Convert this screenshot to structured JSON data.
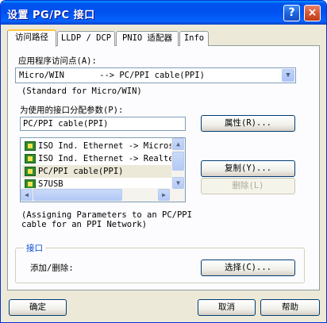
{
  "window": {
    "title": "设置 PG/PC 接口",
    "help_glyph": "?",
    "close_glyph": "×"
  },
  "tabs": [
    {
      "label": "访问路径",
      "active": true
    },
    {
      "label": "LLDP / DCP",
      "active": false
    },
    {
      "label": "PNIO 适配器",
      "active": false
    },
    {
      "label": "Info",
      "active": false
    }
  ],
  "access_point": {
    "label": "应用程序访问点(A):",
    "value": "Micro/WIN       --> PC/PPI cable(PPI)",
    "description": "(Standard for Micro/WIN)"
  },
  "interface_param": {
    "label": "为使用的接口分配参数(P):",
    "value": "PC/PPI cable(PPI)",
    "items": [
      {
        "label": "ISO Ind. Ethernet -> Microso",
        "selected": false
      },
      {
        "label": "ISO Ind. Ethernet -> Realtek",
        "selected": false
      },
      {
        "label": "PC/PPI cable(PPI)",
        "selected": true
      },
      {
        "label": "S7USB",
        "selected": false
      }
    ],
    "description_line1": "(Assigning Parameters to an PC/PPI",
    "description_line2": "cable for an PPI Network)"
  },
  "buttons": {
    "properties": "属性(R)...",
    "copy": "复制(Y)...",
    "delete": "删除(L)",
    "select": "选择(C)...",
    "ok": "确定",
    "cancel": "取消",
    "help": "帮助"
  },
  "interface_group": {
    "title": "接口",
    "add_remove_label": "添加/删除:"
  },
  "icons": {
    "list_item": "network-adapter-icon",
    "dropdown": "chevron-down-icon"
  }
}
